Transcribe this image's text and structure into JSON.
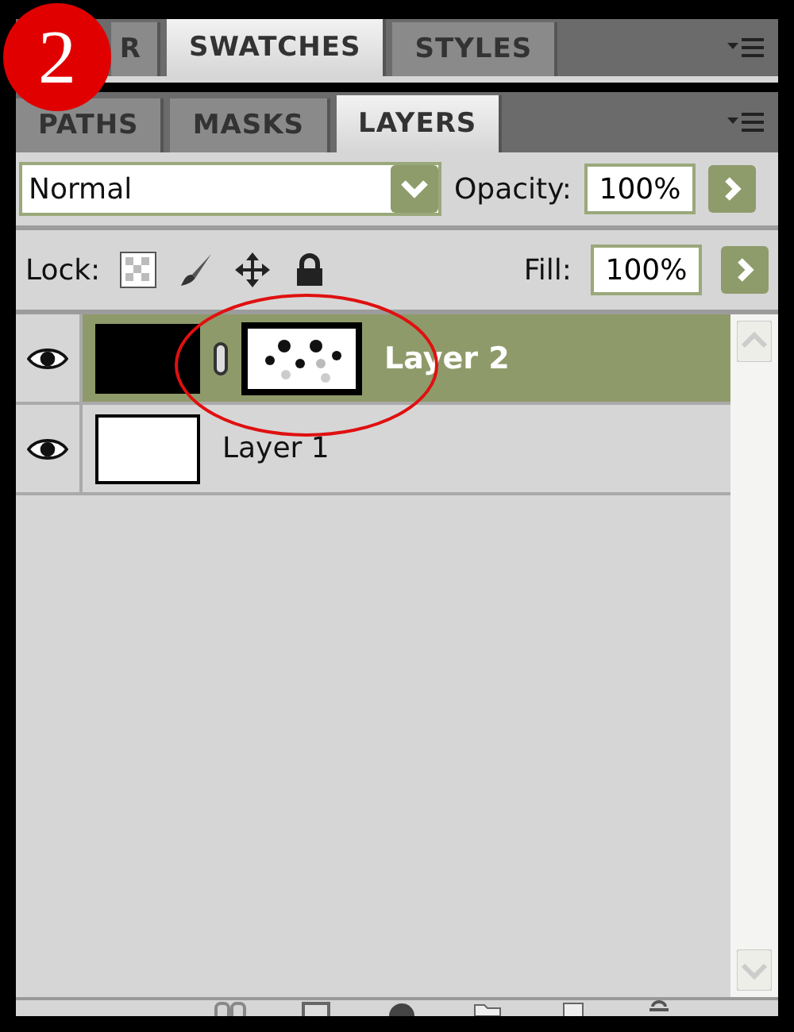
{
  "badge": "2",
  "tab_groups": [
    {
      "tabs": [
        {
          "label": "R",
          "selected": false
        },
        {
          "label": "SWATCHES",
          "selected": true
        },
        {
          "label": "STYLES",
          "selected": false
        }
      ]
    },
    {
      "tabs": [
        {
          "label": "PATHS",
          "selected": false
        },
        {
          "label": "MASKS",
          "selected": false
        },
        {
          "label": "LAYERS",
          "selected": true
        }
      ]
    }
  ],
  "blend_mode": {
    "value": "Normal"
  },
  "opacity": {
    "label": "Opacity:",
    "value": "100%"
  },
  "lock": {
    "label": "Lock:"
  },
  "fill": {
    "label": "Fill:",
    "value": "100%"
  },
  "layers": [
    {
      "name": "Layer 2",
      "selected": true,
      "visible": true,
      "thumbnail_dark": true,
      "mask": true
    },
    {
      "name": "Layer 1",
      "selected": false,
      "visible": true,
      "thumbnail_dark": false,
      "mask": false
    }
  ]
}
